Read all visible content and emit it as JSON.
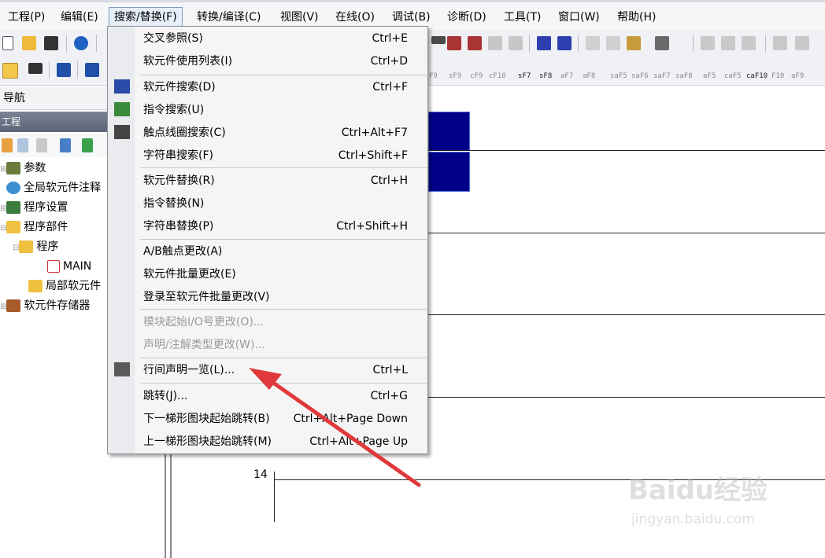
{
  "menubar": {
    "items": [
      {
        "label": "工程(P)"
      },
      {
        "label": "编辑(E)"
      },
      {
        "label": "搜索/替换(F)"
      },
      {
        "label": "转换/编译(C)"
      },
      {
        "label": "视图(V)"
      },
      {
        "label": "在线(O)"
      },
      {
        "label": "调试(B)"
      },
      {
        "label": "诊断(D)"
      },
      {
        "label": "工具(T)"
      },
      {
        "label": "窗口(W)"
      },
      {
        "label": "帮助(H)"
      }
    ],
    "active_index": 2
  },
  "toolbar2": {
    "function_keys": [
      "F9",
      "sF9",
      "cF9",
      "cF10",
      "sF7",
      "sF8",
      "aF7",
      "aF8",
      "saF5",
      "saF6",
      "saF7",
      "saF8",
      "aF5",
      "caF5",
      "caF10",
      "F10",
      "aF9"
    ]
  },
  "nav": {
    "header": "导航",
    "project_bar": "工程",
    "tree": [
      {
        "label": "参数"
      },
      {
        "label": "全局软元件注释"
      },
      {
        "label": "程序设置"
      },
      {
        "label": "程序部件"
      },
      {
        "label": "程序"
      },
      {
        "label": "MAIN"
      },
      {
        "label": "局部软元件"
      },
      {
        "label": "软元件存储器"
      }
    ]
  },
  "ladder": {
    "row_number": "14"
  },
  "dropdown": {
    "items": [
      {
        "label": "交叉参照(S)",
        "shortcut": "Ctrl+E",
        "enabled": true
      },
      {
        "label": "软元件使用列表(I)",
        "shortcut": "Ctrl+D",
        "enabled": true
      },
      {
        "label": "软元件搜索(D)",
        "shortcut": "Ctrl+F",
        "enabled": true
      },
      {
        "label": "指令搜索(U)",
        "shortcut": "",
        "enabled": true
      },
      {
        "label": "触点线圈搜索(C)",
        "shortcut": "Ctrl+Alt+F7",
        "enabled": true
      },
      {
        "label": "字符串搜索(F)",
        "shortcut": "Ctrl+Shift+F",
        "enabled": true
      },
      {
        "label": "软元件替换(R)",
        "shortcut": "Ctrl+H",
        "enabled": true
      },
      {
        "label": "指令替换(N)",
        "shortcut": "",
        "enabled": true
      },
      {
        "label": "字符串替换(P)",
        "shortcut": "Ctrl+Shift+H",
        "enabled": true
      },
      {
        "label": "A/B触点更改(A)",
        "shortcut": "",
        "enabled": true
      },
      {
        "label": "软元件批量更改(E)",
        "shortcut": "",
        "enabled": true
      },
      {
        "label": "登录至软元件批量更改(V)",
        "shortcut": "",
        "enabled": true
      },
      {
        "label": "模块起始I/O号更改(O)...",
        "shortcut": "",
        "enabled": false
      },
      {
        "label": "声明/注解类型更改(W)...",
        "shortcut": "",
        "enabled": false
      },
      {
        "label": "行间声明一览(L)...",
        "shortcut": "Ctrl+L",
        "enabled": true
      },
      {
        "label": "跳转(J)...",
        "shortcut": "Ctrl+G",
        "enabled": true
      },
      {
        "label": "下一梯形图块起始跳转(B)",
        "shortcut": "Ctrl+Alt+Page Down",
        "enabled": true
      },
      {
        "label": "上一梯形图块起始跳转(M)",
        "shortcut": "Ctrl+Alt+Page Up",
        "enabled": true
      }
    ]
  },
  "watermark": {
    "brand": "Baidu经验",
    "url": "jingyan.baidu.com"
  },
  "colors": {
    "cursor_block": "#00008b",
    "arrow": "#e0393b",
    "menu_highlight_border": "#7a9ac4"
  }
}
